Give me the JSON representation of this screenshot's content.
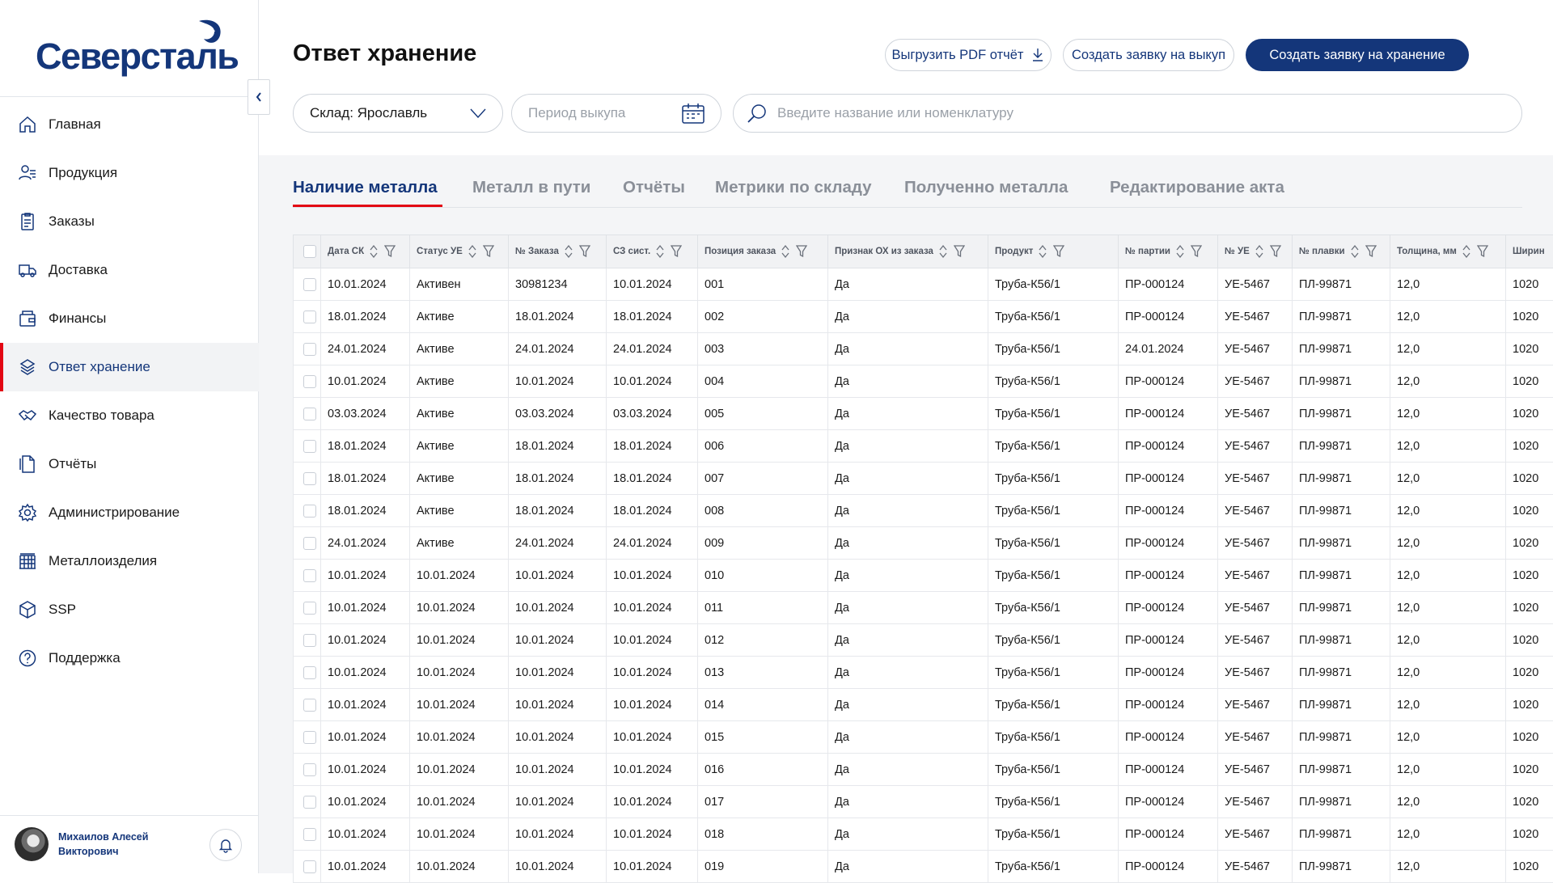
{
  "brand": {
    "name": "Северсталь"
  },
  "sidebar": {
    "items": [
      {
        "label": "Главная",
        "icon": "home-icon"
      },
      {
        "label": "Продукция",
        "icon": "products-icon"
      },
      {
        "label": "Заказы",
        "icon": "orders-icon"
      },
      {
        "label": "Доставка",
        "icon": "truck-icon"
      },
      {
        "label": "Финансы",
        "icon": "wallet-icon"
      },
      {
        "label": "Ответ хранение",
        "icon": "layers-icon",
        "active": true
      },
      {
        "label": "Качество товара",
        "icon": "handshake-icon"
      },
      {
        "label": "Отчёты",
        "icon": "reports-icon"
      },
      {
        "label": "Администрирование",
        "icon": "gear-icon"
      },
      {
        "label": "Металлоизделия",
        "icon": "structure-icon"
      },
      {
        "label": "SSP",
        "icon": "cube-icon"
      },
      {
        "label": "Поддержка",
        "icon": "help-icon"
      }
    ]
  },
  "user": {
    "name_line1": "Михаилов Алесей",
    "name_line2": "Викторович"
  },
  "page": {
    "title": "Ответ хранение"
  },
  "actions": {
    "pdf": "Выгрузить PDF отчёт",
    "buyout": "Создать заявку на выкуп",
    "storage": "Создать заявку на хранение"
  },
  "filters": {
    "warehouse": "Склад: Ярославль",
    "period_placeholder": "Период выкупа",
    "search_placeholder": "Введите название или номенклатуру"
  },
  "tabs": [
    {
      "label": "Наличие металла",
      "active": true
    },
    {
      "label": "Металл в пути"
    },
    {
      "label": "Отчёты"
    },
    {
      "label": "Метрики по складу"
    },
    {
      "label": "Полученно металла"
    },
    {
      "label": "Редактирование акта"
    }
  ],
  "table": {
    "columns": [
      "Дата СК",
      "Статус УЕ",
      "№ Заказа",
      "СЗ сист.",
      "Позиция заказа",
      "Признак ОХ из заказа",
      "Продукт",
      "№ партии",
      "№ УЕ",
      "№ плавки",
      "Толщина, мм",
      "Ширин"
    ],
    "rows": [
      [
        "10.01.2024",
        "Активен",
        "30981234",
        "10.01.2024",
        "001",
        "Да",
        "Труба-К56/1",
        "ПР-000124",
        "УЕ-5467",
        "ПЛ-99871",
        "12,0",
        "1020"
      ],
      [
        "18.01.2024",
        "Активе",
        "18.01.2024",
        "18.01.2024",
        "002",
        "Да",
        "Труба-К56/1",
        "ПР-000124",
        "УЕ-5467",
        "ПЛ-99871",
        "12,0",
        "1020"
      ],
      [
        "24.01.2024",
        "Активе",
        "24.01.2024",
        "24.01.2024",
        "003",
        "Да",
        "Труба-К56/1",
        "24.01.2024",
        "УЕ-5467",
        "ПЛ-99871",
        "12,0",
        "1020"
      ],
      [
        "10.01.2024",
        "Активе",
        "10.01.2024",
        "10.01.2024",
        "004",
        "Да",
        "Труба-К56/1",
        "ПР-000124",
        "УЕ-5467",
        "ПЛ-99871",
        "12,0",
        "1020"
      ],
      [
        "03.03.2024",
        "Активе",
        "03.03.2024",
        "03.03.2024",
        "005",
        "Да",
        "Труба-К56/1",
        "ПР-000124",
        "УЕ-5467",
        "ПЛ-99871",
        "12,0",
        "1020"
      ],
      [
        "18.01.2024",
        "Активе",
        "18.01.2024",
        "18.01.2024",
        "006",
        "Да",
        "Труба-К56/1",
        "ПР-000124",
        "УЕ-5467",
        "ПЛ-99871",
        "12,0",
        "1020"
      ],
      [
        "18.01.2024",
        "Активе",
        "18.01.2024",
        "18.01.2024",
        "007",
        "Да",
        "Труба-К56/1",
        "ПР-000124",
        "УЕ-5467",
        "ПЛ-99871",
        "12,0",
        "1020"
      ],
      [
        "18.01.2024",
        "Активе",
        "18.01.2024",
        "18.01.2024",
        "008",
        "Да",
        "Труба-К56/1",
        "ПР-000124",
        "УЕ-5467",
        "ПЛ-99871",
        "12,0",
        "1020"
      ],
      [
        "24.01.2024",
        "Активе",
        "24.01.2024",
        "24.01.2024",
        "009",
        "Да",
        "Труба-К56/1",
        "ПР-000124",
        "УЕ-5467",
        "ПЛ-99871",
        "12,0",
        "1020"
      ],
      [
        "10.01.2024",
        "10.01.2024",
        "10.01.2024",
        "10.01.2024",
        "010",
        "Да",
        "Труба-К56/1",
        "ПР-000124",
        "УЕ-5467",
        "ПЛ-99871",
        "12,0",
        "1020"
      ],
      [
        "10.01.2024",
        "10.01.2024",
        "10.01.2024",
        "10.01.2024",
        "011",
        "Да",
        "Труба-К56/1",
        "ПР-000124",
        "УЕ-5467",
        "ПЛ-99871",
        "12,0",
        "1020"
      ],
      [
        "10.01.2024",
        "10.01.2024",
        "10.01.2024",
        "10.01.2024",
        "012",
        "Да",
        "Труба-К56/1",
        "ПР-000124",
        "УЕ-5467",
        "ПЛ-99871",
        "12,0",
        "1020"
      ],
      [
        "10.01.2024",
        "10.01.2024",
        "10.01.2024",
        "10.01.2024",
        "013",
        "Да",
        "Труба-К56/1",
        "ПР-000124",
        "УЕ-5467",
        "ПЛ-99871",
        "12,0",
        "1020"
      ],
      [
        "10.01.2024",
        "10.01.2024",
        "10.01.2024",
        "10.01.2024",
        "014",
        "Да",
        "Труба-К56/1",
        "ПР-000124",
        "УЕ-5467",
        "ПЛ-99871",
        "12,0",
        "1020"
      ],
      [
        "10.01.2024",
        "10.01.2024",
        "10.01.2024",
        "10.01.2024",
        "015",
        "Да",
        "Труба-К56/1",
        "ПР-000124",
        "УЕ-5467",
        "ПЛ-99871",
        "12,0",
        "1020"
      ],
      [
        "10.01.2024",
        "10.01.2024",
        "10.01.2024",
        "10.01.2024",
        "016",
        "Да",
        "Труба-К56/1",
        "ПР-000124",
        "УЕ-5467",
        "ПЛ-99871",
        "12,0",
        "1020"
      ],
      [
        "10.01.2024",
        "10.01.2024",
        "10.01.2024",
        "10.01.2024",
        "017",
        "Да",
        "Труба-К56/1",
        "ПР-000124",
        "УЕ-5467",
        "ПЛ-99871",
        "12,0",
        "1020"
      ],
      [
        "10.01.2024",
        "10.01.2024",
        "10.01.2024",
        "10.01.2024",
        "018",
        "Да",
        "Труба-К56/1",
        "ПР-000124",
        "УЕ-5467",
        "ПЛ-99871",
        "12,0",
        "1020"
      ],
      [
        "10.01.2024",
        "10.01.2024",
        "10.01.2024",
        "10.01.2024",
        "019",
        "Да",
        "Труба-К56/1",
        "ПР-000124",
        "УЕ-5467",
        "ПЛ-99871",
        "12,0",
        "1020"
      ]
    ]
  },
  "colors": {
    "brand_blue": "#14367a",
    "accent_red": "#e30613",
    "muted_text": "#8a8f98"
  }
}
